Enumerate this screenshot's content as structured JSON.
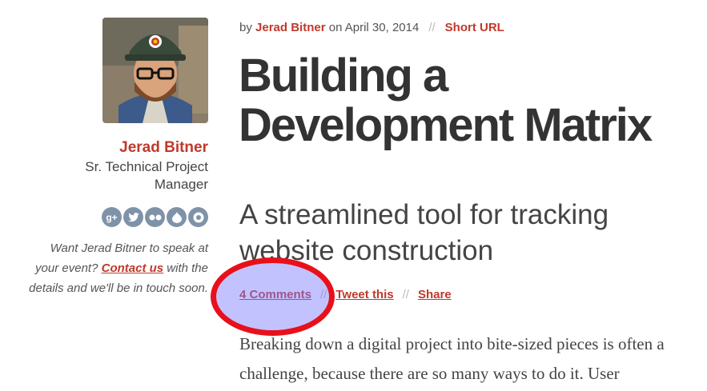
{
  "sidebar": {
    "author_name": "Jerad Bitner",
    "author_title": "Sr. Technical Project Manager",
    "social_icons": [
      "google-plus-icon",
      "twitter-icon",
      "flickr-icon",
      "drupal-icon",
      "github-icon"
    ],
    "speak_text_1": "Want Jerad Bitner to speak at your event? ",
    "contact_label": "Contact us",
    "speak_text_2": " with the details and we'll be in touch soon."
  },
  "meta": {
    "by": "by ",
    "author_link": "Jerad Bitner",
    "on_date": " on April 30, 2014",
    "separator": "//",
    "short_url": "Short URL"
  },
  "article": {
    "title": "Building a Development Matrix",
    "subtitle": "A streamlined tool for tracking website construction",
    "body": "Breaking down a digital project into bite-sized pieces is often a challenge, because there are so many ways to do it. User"
  },
  "actions": {
    "comments": "4 Comments",
    "tweet": "Tweet this",
    "share": "Share",
    "separator": "//"
  },
  "colors": {
    "accent": "#c0392b",
    "highlight_ring": "#e8101a",
    "highlight_fill": "#7878ff"
  }
}
